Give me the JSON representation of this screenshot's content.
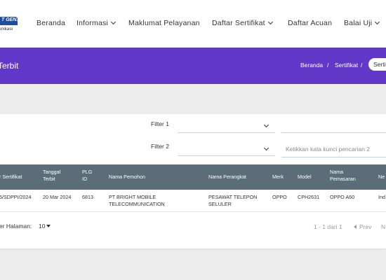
{
  "nav": {
    "logo_text": "T GEN.",
    "logo_sub": "unikasi",
    "items": [
      {
        "label": "Beranda",
        "dropdown": false
      },
      {
        "label": "Informasi",
        "dropdown": true
      },
      {
        "label": "Maklumat Pelayanan",
        "dropdown": false
      },
      {
        "label": "Daftar Sertifikat",
        "dropdown": true
      },
      {
        "label": "Daftar Acuan",
        "dropdown": false
      },
      {
        "label": "Balai Uji",
        "dropdown": true
      }
    ]
  },
  "header": {
    "title": "Terbit",
    "breadcrumb": [
      "Beranda",
      "Sertifikat",
      "Serti"
    ],
    "separator": "/",
    "bg_color": "#6138c7"
  },
  "filters": {
    "filter1_label": "Filter 1",
    "filter2_label": "Filter 2",
    "filter1_value": "",
    "filter2_value": "",
    "search1_value": "",
    "search2_placeholder": "Ketikkan kata kunci pencarian 2"
  },
  "table": {
    "header_color": "#5b6d79",
    "columns": [
      [
        "r Sertifikat"
      ],
      [
        "Tanggal",
        "Terbit"
      ],
      [
        "PLG",
        "ID"
      ],
      [
        "Nama Pemohon"
      ],
      [
        "Nama Perangkat"
      ],
      [
        "Merk"
      ],
      [
        "Model"
      ],
      [
        "Nama",
        "Pemasaran"
      ],
      [
        "Ne"
      ]
    ],
    "rows": [
      {
        "sertifikat": "5/SDPPI/2024",
        "tanggal": "20 Mar 2024",
        "plg_id": "6813",
        "pemohon": [
          "PT BRIGHT MOBILE",
          "TELECOMMUNICATION"
        ],
        "perangkat": [
          "PESAWAT TELEPON",
          "SELULER"
        ],
        "merk": "OPPO",
        "model": "CPH2631",
        "pemasaran": "OPPO A60",
        "negara": "Ind"
      }
    ]
  },
  "pagination": {
    "per_page_label": "er Halaman:",
    "per_page_value": "10",
    "range": "1 - 1 dari 1",
    "prev": "Prev",
    "next": "N"
  }
}
